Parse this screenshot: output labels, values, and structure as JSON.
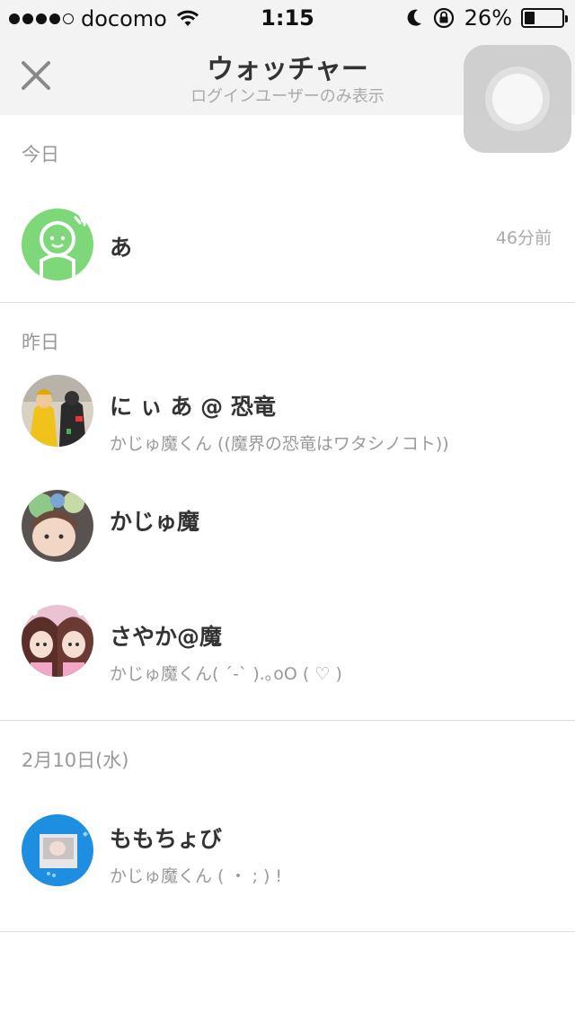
{
  "status_bar": {
    "carrier": "docomo",
    "time": "1:15",
    "battery": "26%",
    "battery_level": 0.26
  },
  "navbar": {
    "title": "ウォッチャー",
    "subtitle": "ログインユーザーのみ表示",
    "close_icon": "close-x"
  },
  "sections": [
    {
      "header": "今日",
      "rows": [
        {
          "name": "あ",
          "comment": "",
          "time": "46分前",
          "avatar": "default-green"
        }
      ]
    },
    {
      "header": "昨日",
      "rows": [
        {
          "name": "に ぃ あ @ 恐竜",
          "comment": "かじゅ魔くん ((魔界の恐竜はワタシノコト))",
          "time": "",
          "avatar": "photo-costume"
        },
        {
          "name": "かじゅ魔",
          "comment": "",
          "time": "",
          "avatar": "photo-stickers"
        },
        {
          "name": "さやか@魔",
          "comment": "かじゅ魔くん( ´-` ).｡oO ( ♡ )",
          "time": "",
          "avatar": "photo-pink-girls"
        }
      ]
    },
    {
      "header": "2月10日(水)",
      "rows": [
        {
          "name": "ももちょび",
          "comment": "かじゅ魔くん ( ・ ; ) !",
          "time": "",
          "avatar": "photo-blue-frame"
        }
      ]
    }
  ],
  "colors": {
    "bar_bg": "#f3f3f3",
    "green_avatar": "#7ed87a",
    "blue_avatar": "#1e8fe0",
    "divider": "#dcdcdc"
  }
}
